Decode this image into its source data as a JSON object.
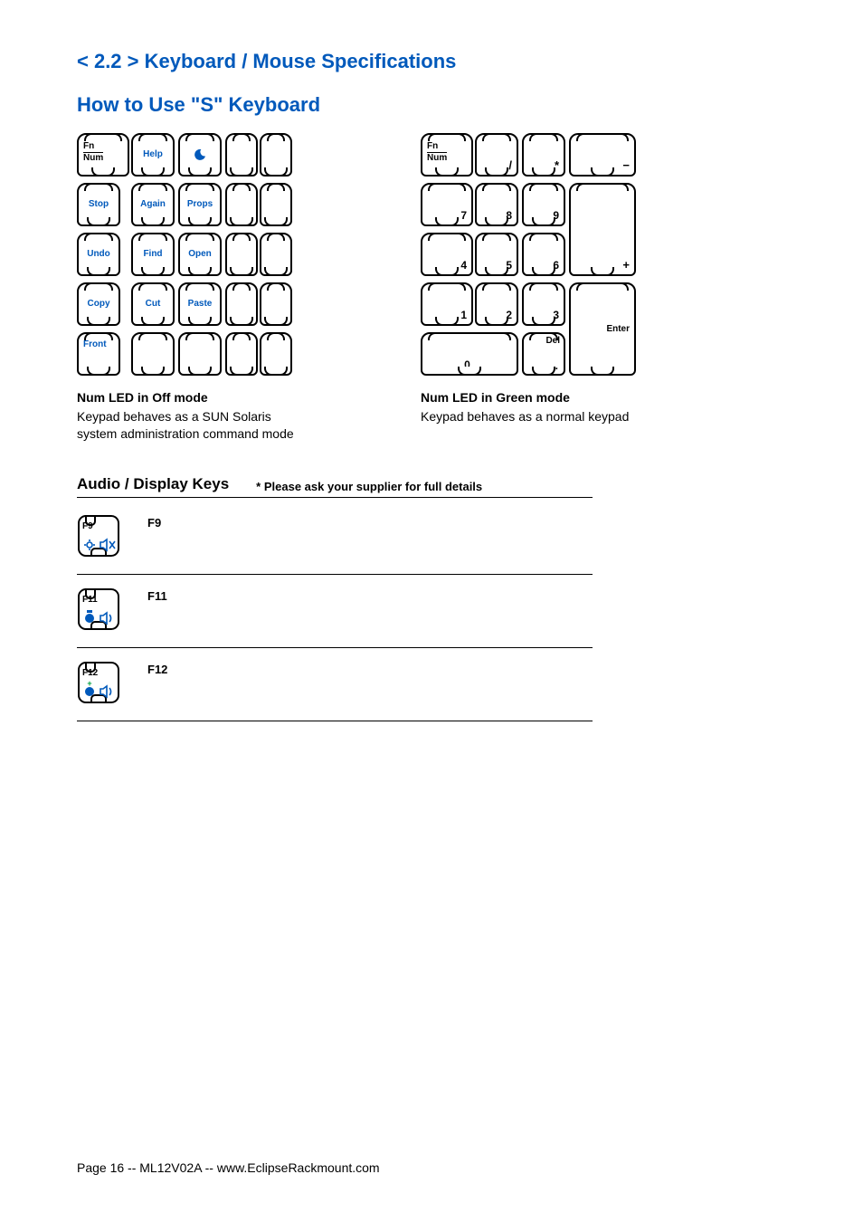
{
  "headings": {
    "section_number": "< 2.2 > Keyboard  /  Mouse Specifications",
    "subtitle": "How to Use \"S\" Keyboard"
  },
  "left_keyboard": {
    "fn_top": "Fn",
    "fn_bottom": "Num",
    "r0": [
      "Help"
    ],
    "r1": [
      "Stop",
      "Again",
      "Props"
    ],
    "r2": [
      "Undo",
      "Find",
      "Open"
    ],
    "r3": [
      "Copy",
      "Cut",
      "Paste"
    ],
    "r4": [
      "Front"
    ],
    "caption_title": "Num LED in Off mode",
    "caption_body": "Keypad behaves as a SUN Solaris system administration command mode"
  },
  "right_keyboard": {
    "fn_top": "Fn",
    "fn_bottom": "Num",
    "ops": [
      "/",
      "*",
      "−"
    ],
    "row_789": [
      "7",
      "8",
      "9"
    ],
    "row_456": [
      "4",
      "5",
      "6"
    ],
    "plus": "+",
    "row_123": [
      "1",
      "2",
      "3"
    ],
    "enter": "Enter",
    "zero": "0",
    "del": "Del",
    "dot": ".",
    "caption_title": "Num LED in Green mode",
    "caption_body": "Keypad behaves as a normal keypad"
  },
  "audio_section": {
    "title": "Audio / Display Keys",
    "note": "* Please ask your supplier for full details",
    "keys": [
      {
        "cap": "F9",
        "label": "F9",
        "icons": [
          "brightness",
          "mute"
        ]
      },
      {
        "cap": "F11",
        "label": "F11",
        "icons": [
          "vol-down",
          "speaker"
        ]
      },
      {
        "cap": "F12",
        "label": "F12",
        "icons": [
          "vol-up",
          "speaker"
        ]
      }
    ]
  },
  "footer": "Page 16 -- ML12V02A -- www.EclipseRackmount.com"
}
